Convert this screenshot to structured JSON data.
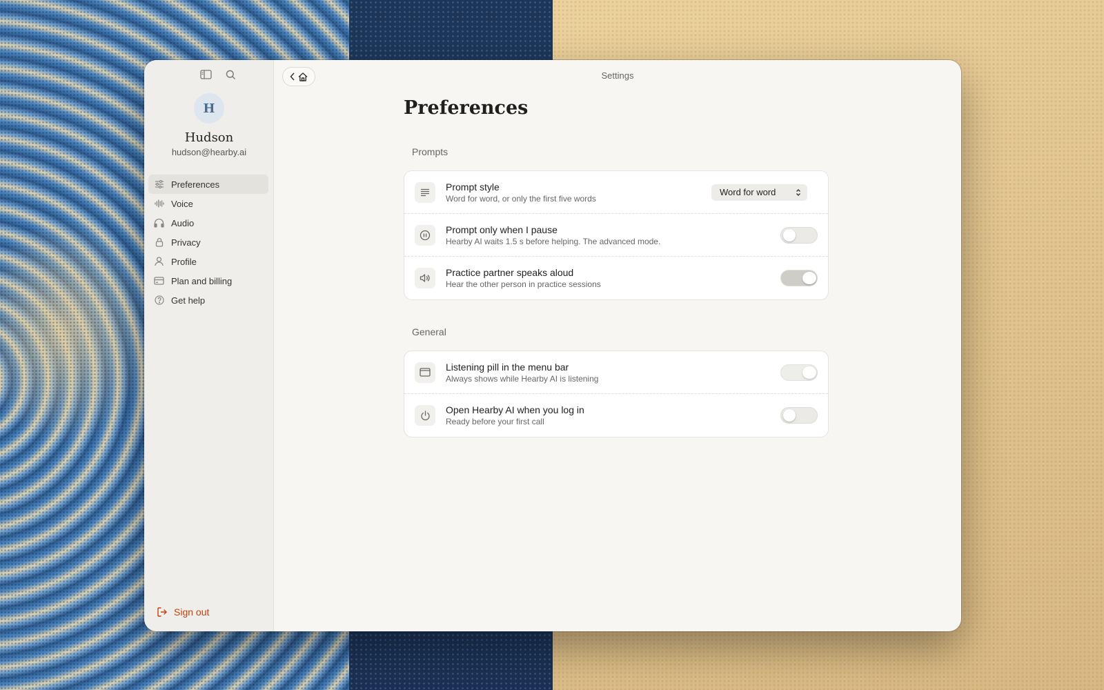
{
  "window": {
    "title": "Settings"
  },
  "user": {
    "initial": "H",
    "name": "Hudson",
    "email": "hudson@hearby.ai"
  },
  "sidebar": {
    "items": [
      {
        "label": "Preferences",
        "icon": "sliders-icon",
        "active": true
      },
      {
        "label": "Voice",
        "icon": "waveform-icon",
        "active": false
      },
      {
        "label": "Audio",
        "icon": "headphones-icon",
        "active": false
      },
      {
        "label": "Privacy",
        "icon": "lock-icon",
        "active": false
      },
      {
        "label": "Profile",
        "icon": "person-icon",
        "active": false
      },
      {
        "label": "Plan and billing",
        "icon": "credit-card-icon",
        "active": false
      },
      {
        "label": "Get help",
        "icon": "help-circle-icon",
        "active": false
      }
    ],
    "sign_out_label": "Sign out"
  },
  "page": {
    "title": "Preferences",
    "sections": [
      {
        "label": "Prompts",
        "rows": [
          {
            "title": "Prompt style",
            "subtitle": "Word for word, or only the first five words",
            "icon": "text-lines-icon",
            "control": "select",
            "value": "Word for word"
          },
          {
            "title": "Prompt only when I pause",
            "subtitle": "Hearby AI waits 1.5 s before helping. The advanced mode.",
            "icon": "pause-circle-icon",
            "control": "toggle",
            "on": false
          },
          {
            "title": "Practice partner speaks aloud",
            "subtitle": "Hear the other person in practice sessions",
            "icon": "speaker-icon",
            "control": "toggle",
            "on": true
          }
        ]
      },
      {
        "label": "General",
        "rows": [
          {
            "title": "Listening pill in the menu bar",
            "subtitle": "Always shows while Hearby AI is listening",
            "icon": "window-icon",
            "control": "toggle",
            "on": true
          },
          {
            "title": "Open Hearby AI when you log in",
            "subtitle": "Ready before your first call",
            "icon": "power-icon",
            "control": "toggle",
            "on": false
          }
        ]
      }
    ]
  },
  "colors": {
    "accent_signout": "#c2410c",
    "window_bg": "#f7f6f2",
    "sidebar_bg": "#efeeea"
  }
}
